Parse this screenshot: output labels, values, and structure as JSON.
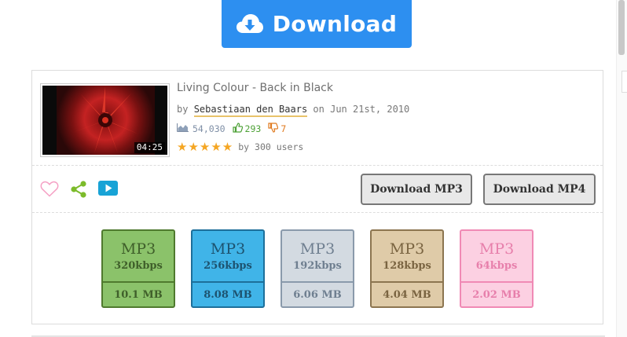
{
  "header": {
    "download_label": "Download",
    "icon": "cloud-download-icon"
  },
  "video": {
    "title": "Living Colour - Back in Black",
    "by_prefix": "by",
    "author": "Sebastiaan den Baars",
    "date_text": "on Jun 21st, 2010",
    "duration": "04:25",
    "views": "54,030",
    "likes": "293",
    "dislikes": "7",
    "rating_stars": 5,
    "rating_text": "by 300 users"
  },
  "actions": {
    "download_mp3": "Download MP3",
    "download_mp4": "Download MP4",
    "icons": [
      "heart-icon",
      "share-icon",
      "play-icon"
    ]
  },
  "formats": [
    {
      "type": "MP3",
      "bitrate": "320kbps",
      "size": "10.1 MB",
      "bg": "#8bc26a",
      "border": "#4f7a2e",
      "text": "#3f5f2a"
    },
    {
      "type": "MP3",
      "bitrate": "256kbps",
      "size": "8.08 MB",
      "bg": "#40b4e8",
      "border": "#1d6f9a",
      "text": "#1d5370"
    },
    {
      "type": "MP3",
      "bitrate": "192kbps",
      "size": "6.06 MB",
      "bg": "#d3dae1",
      "border": "#8a9aab",
      "text": "#6f7f90"
    },
    {
      "type": "MP3",
      "bitrate": "128kbps",
      "size": "4.04 MB",
      "bg": "#dfcba8",
      "border": "#8c7550",
      "text": "#7a6441"
    },
    {
      "type": "MP3",
      "bitrate": "64kbps",
      "size": "2.02 MB",
      "bg": "#fcd0e2",
      "border": "#f08ab5",
      "text": "#e77fab"
    }
  ],
  "colors": {
    "accent": "#2d8ff0",
    "star": "#f5a623",
    "like": "#4da136",
    "dislike": "#e07a1e"
  }
}
